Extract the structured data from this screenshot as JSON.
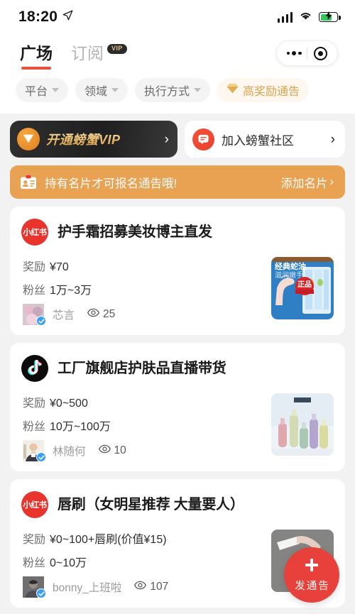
{
  "status_bar": {
    "time": "18:20",
    "location_icon": "location-arrow-icon",
    "signal_icon": "cellular-signal-icon",
    "wifi_icon": "wifi-icon",
    "battery_icon": "battery-charging-icon",
    "battery_color": "#34c759"
  },
  "header": {
    "tabs": [
      {
        "label": "广场",
        "active": true,
        "badge": null
      },
      {
        "label": "订阅",
        "active": false,
        "badge": "VIP"
      }
    ],
    "accent_color": "#e8503a",
    "more_icon": "more-dots-icon",
    "target_icon": "target-icon"
  },
  "filters": [
    {
      "label": "平台",
      "type": "dropdown",
      "highlight": false
    },
    {
      "label": "领域",
      "type": "dropdown",
      "highlight": false
    },
    {
      "label": "执行方式",
      "type": "dropdown",
      "highlight": false
    },
    {
      "label": "高奖励通告",
      "type": "toggle",
      "highlight": true,
      "icon": "diamond-icon",
      "color": "#d8a44f"
    }
  ],
  "banners": {
    "vip": {
      "label": "开通螃蟹VIP",
      "icon": "vip-diamond-icon",
      "arrow": "›",
      "background": "#2a2a2a",
      "text_color": "#e9b96a"
    },
    "community": {
      "label": "加入螃蟹社区",
      "icon": "chat-bubble-icon",
      "arrow": "›",
      "icon_color": "#ec4a32"
    }
  },
  "notice": {
    "icon": "id-card-icon",
    "text": "持有名片才可报名通告哦!",
    "action_label": "添加名片",
    "action_arrow": "›",
    "background": "#e8a252"
  },
  "cards": [
    {
      "platform": "xiaohongshu",
      "platform_label": "小红书",
      "title": "护手霜招募美妆博主直发",
      "reward_key": "奖励",
      "reward_value": "¥70",
      "fans_key": "粉丝",
      "fans_value": "1万~3万",
      "author": "芯言",
      "verified": true,
      "views_icon": "eye-icon",
      "views": "25",
      "thumbnail": "hand-cream-product-photo"
    },
    {
      "platform": "douyin",
      "platform_label": "抖音",
      "title": "工厂旗舰店护肤品直播带货",
      "reward_key": "奖励",
      "reward_value": "¥0~500",
      "fans_key": "粉丝",
      "fans_value": "10万~100万",
      "author": "林随何",
      "verified": true,
      "views_icon": "eye-icon",
      "views": "10",
      "thumbnail": "skincare-bottles-photo"
    },
    {
      "platform": "xiaohongshu",
      "platform_label": "小红书",
      "title": "唇刷（女明星推荐 大量要人）",
      "reward_key": "奖励",
      "reward_value": "¥0~100+唇刷(价值¥15)",
      "fans_key": "粉丝",
      "fans_value": "0~10万",
      "author": "bonny_上班啦",
      "verified": true,
      "views_icon": "eye-icon",
      "views": "107",
      "thumbnail": "lip-brush-in-hand-photo"
    }
  ],
  "fab": {
    "icon": "plus-icon",
    "label": "发通告",
    "color": "#e8403a"
  }
}
